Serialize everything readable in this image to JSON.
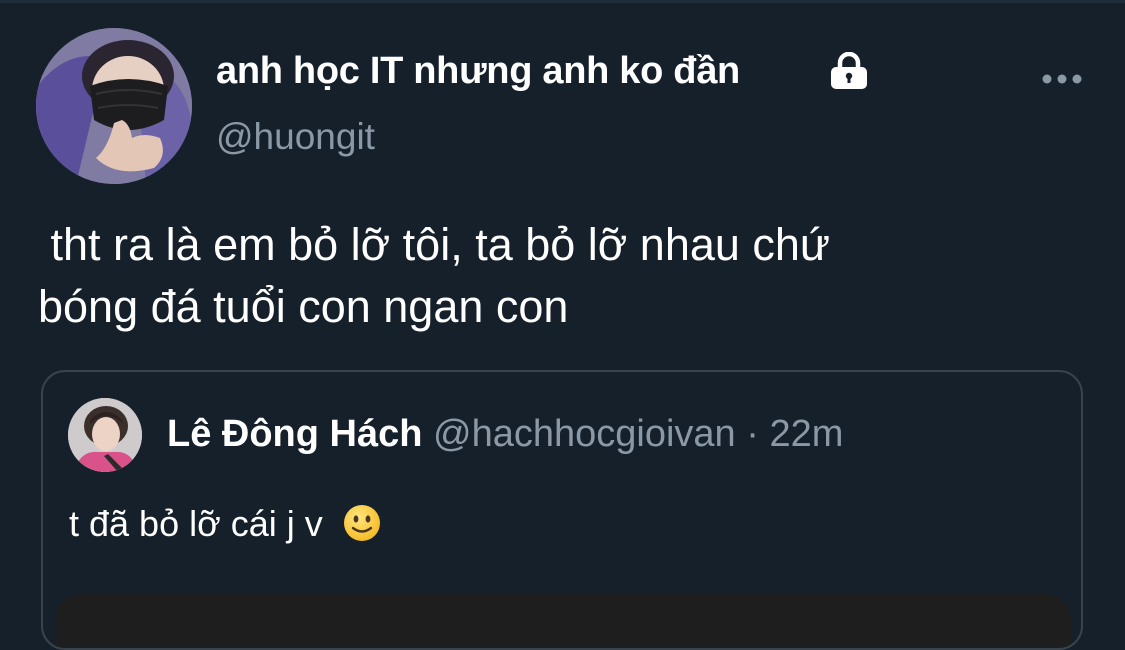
{
  "tweet": {
    "author": {
      "name": "anh học IT nhưng anh ko đần",
      "handle": "@huongit",
      "avatar_icon": "user-avatar-masked",
      "protected_icon": "lock-icon"
    },
    "more_icon": "more-horizontal-icon",
    "text": " tht ra là em bỏ lỡ tôi, ta bỏ lỡ nhau chứ\nbóng đá tuổi con ngan con",
    "quoted": {
      "name": "Lê Đông Hách",
      "handle": "@hachhocgioivan",
      "separator": "·",
      "time": "22m",
      "text": "t đã bỏ lỡ cái j v",
      "emoji": "slightly-smiling-face-emoji"
    }
  },
  "colors": {
    "background": "#15202b",
    "text": "#ffffff",
    "secondary_text": "#8b98a5",
    "border": "#38444d"
  }
}
